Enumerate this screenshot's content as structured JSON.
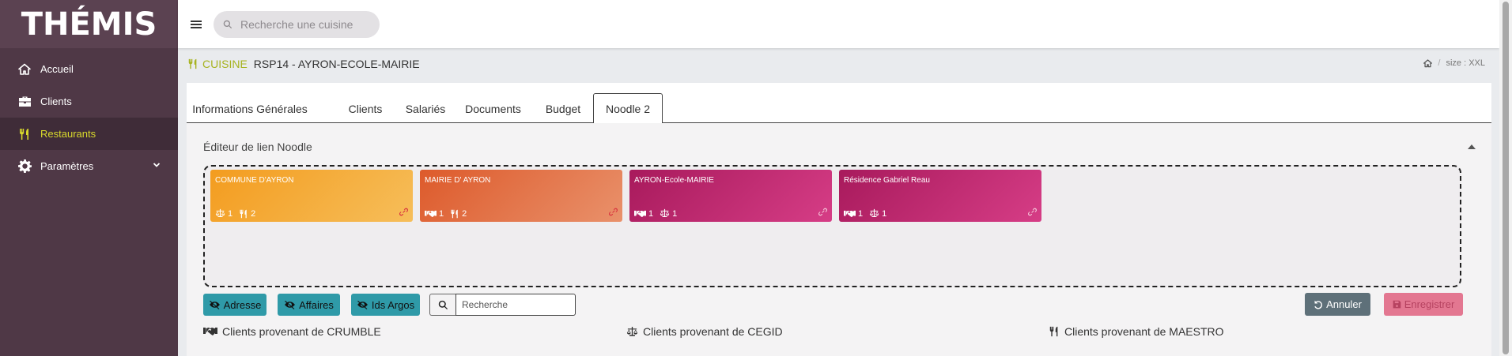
{
  "app": {
    "logo": "THÉMIS"
  },
  "sidebar": {
    "items": [
      {
        "label": "Accueil",
        "icon": "home-icon"
      },
      {
        "label": "Clients",
        "icon": "briefcase-icon"
      },
      {
        "label": "Restaurants",
        "icon": "cutlery-icon",
        "active": true
      },
      {
        "label": "Paramètres",
        "icon": "gear-icon",
        "has_submenu": true
      }
    ]
  },
  "topbar": {
    "search_placeholder": "Recherche une cuisine"
  },
  "page": {
    "category": "CUISINE",
    "name": "RSP14 - AYRON-ECOLE-MAIRIE",
    "breadcrumb_sep": "/",
    "size_label": "size : XXL"
  },
  "tabs": [
    {
      "label": "Informations Générales"
    },
    {
      "label": "Clients"
    },
    {
      "label": "Salariés"
    },
    {
      "label": "Documents"
    },
    {
      "label": "Budget"
    },
    {
      "label": "Noodle 2",
      "active": true
    }
  ],
  "editor": {
    "title": "Éditeur de lien Noodle",
    "tiles": [
      {
        "name": "COMMUNE D'AYRON",
        "stat1": "1",
        "stat1_icon": "scale-icon",
        "stat2": "2",
        "stat2_icon": "cutlery-icon",
        "color_start": "#f39c1f",
        "color_end": "#f6be5a"
      },
      {
        "name": "MAIRIE D' AYRON",
        "stat1": "1",
        "stat1_icon": "handshake-icon",
        "stat2": "2",
        "stat2_icon": "cutlery-icon",
        "color_start": "#dd5a2b",
        "color_end": "#e9916b"
      },
      {
        "name": "AYRON-Ecole-MAIRIE",
        "stat1": "1",
        "stat1_icon": "handshake-icon",
        "stat2": "1",
        "stat2_icon": "scale-icon",
        "color_start": "#a81a5c",
        "color_end": "#d63d86"
      },
      {
        "name": "Résidence Gabriel Reau",
        "stat1": "1",
        "stat1_icon": "handshake-icon",
        "stat2": "1",
        "stat2_icon": "scale-icon",
        "color_start": "#a81a5c",
        "color_end": "#d63d86"
      }
    ]
  },
  "toolbar": {
    "adresse": "Adresse",
    "affaires": "Affaires",
    "ids_argos": "Ids Argos",
    "search_placeholder": "Recherche",
    "cancel": "Annuler",
    "save": "Enregistrer"
  },
  "sources": [
    {
      "label": "Clients provenant de CRUMBLE",
      "icon": "handshake-icon"
    },
    {
      "label": "Clients provenant de CEGID",
      "icon": "scale-icon"
    },
    {
      "label": "Clients provenant de MAESTRO",
      "icon": "cutlery-icon"
    }
  ],
  "colors": {
    "sidebar": "#4f3846",
    "accent": "#a7b320",
    "teal": "#2f9aa8"
  }
}
